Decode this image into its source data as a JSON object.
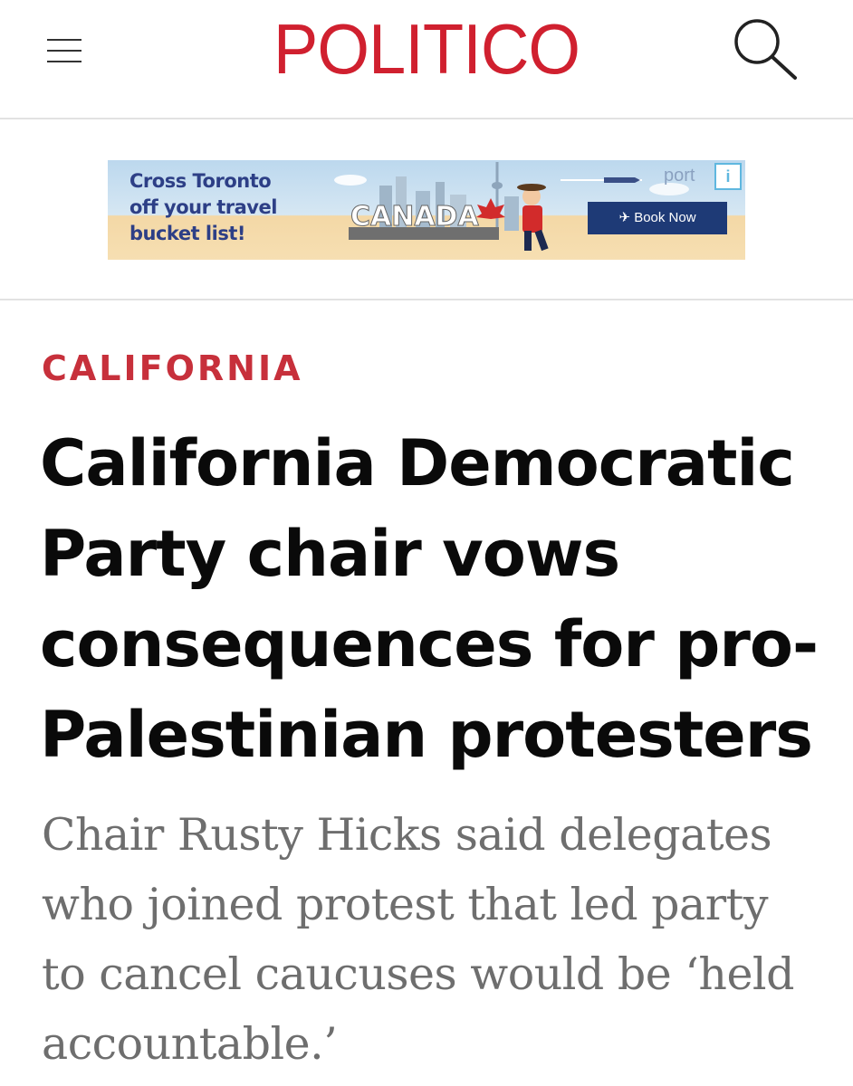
{
  "header": {
    "logo_text": "POLITICO",
    "menu_icon": "hamburger-menu-icon",
    "search_icon": "search-icon",
    "brand_color": "#d0202f"
  },
  "ad": {
    "headline_lines": [
      "Cross Toronto",
      "off your travel",
      "bucket list!"
    ],
    "sign_text": "CANADA",
    "brand": "port",
    "cta_label": "Book Now",
    "adchoices_icon": "adchoices-icon",
    "plane_icon": "plane-icon"
  },
  "article": {
    "kicker": "CALIFORNIA",
    "headline_lines": [
      "California Democratic",
      "Party chair vows",
      "consequences for pro-",
      "Palestinian protesters"
    ],
    "subhead_lines": [
      "Chair Rusty Hicks said delegates",
      "who joined protest that led party",
      "to cancel caucuses would be ‘held",
      "accountable.’"
    ],
    "kicker_color": "#c7303b",
    "subhead_color": "#6e6e6e"
  }
}
